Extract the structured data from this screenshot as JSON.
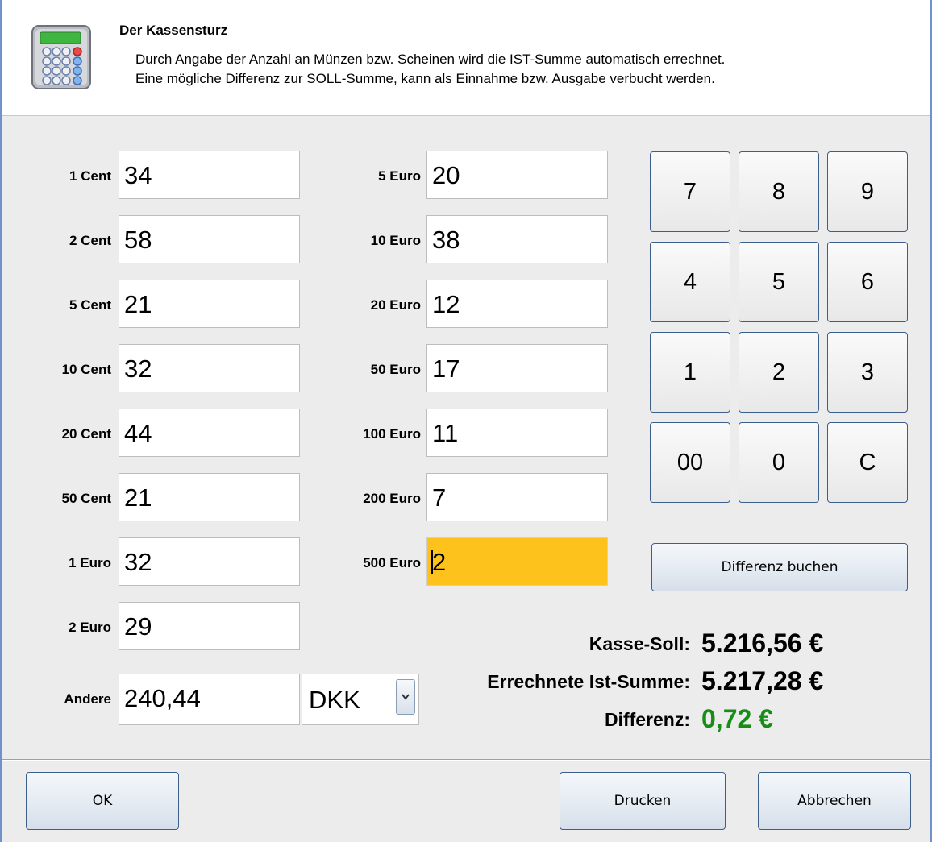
{
  "header": {
    "title": "Der Kassensturz",
    "description_line1": "Durch Angabe der Anzahl an Münzen bzw. Scheinen wird die IST-Summe automatisch errechnet.",
    "description_line2": "Eine mögliche Differenz zur SOLL-Summe, kann als Einnahme bzw. Ausgabe verbucht werden.",
    "icon": "calculator-icon"
  },
  "coins": [
    {
      "label": "1 Cent",
      "value": "34"
    },
    {
      "label": "2 Cent",
      "value": "58"
    },
    {
      "label": "5 Cent",
      "value": "21"
    },
    {
      "label": "10 Cent",
      "value": "32"
    },
    {
      "label": "20 Cent",
      "value": "44"
    },
    {
      "label": "50 Cent",
      "value": "21"
    },
    {
      "label": "1 Euro",
      "value": "32"
    },
    {
      "label": "2 Euro",
      "value": "29"
    }
  ],
  "notes": [
    {
      "label": "5 Euro",
      "value": "20"
    },
    {
      "label": "10 Euro",
      "value": "38"
    },
    {
      "label": "20 Euro",
      "value": "12"
    },
    {
      "label": "50 Euro",
      "value": "17"
    },
    {
      "label": "100 Euro",
      "value": "11"
    },
    {
      "label": "200 Euro",
      "value": "7"
    },
    {
      "label": "500 Euro",
      "value": "2"
    }
  ],
  "other": {
    "label": "Andere",
    "value": "240,44",
    "currency": "DKK"
  },
  "keypad": {
    "keys": [
      "7",
      "8",
      "9",
      "4",
      "5",
      "6",
      "1",
      "2",
      "3",
      "00",
      "0",
      "C"
    ]
  },
  "differenz_button": "Differenz buchen",
  "summary": {
    "soll_label": "Kasse-Soll:",
    "soll_value": "5.216,56 €",
    "ist_label": "Errechnete Ist-Summe:",
    "ist_value": "5.217,28 €",
    "diff_label": "Differenz:",
    "diff_value": "0,72 €",
    "diff_color": "#178d17"
  },
  "footer": {
    "ok_label": "OK",
    "print_label": "Drucken",
    "cancel_label": "Abbrechen"
  },
  "colors": {
    "active_field": "#fdc21b",
    "window_border": "#6f93c8"
  }
}
